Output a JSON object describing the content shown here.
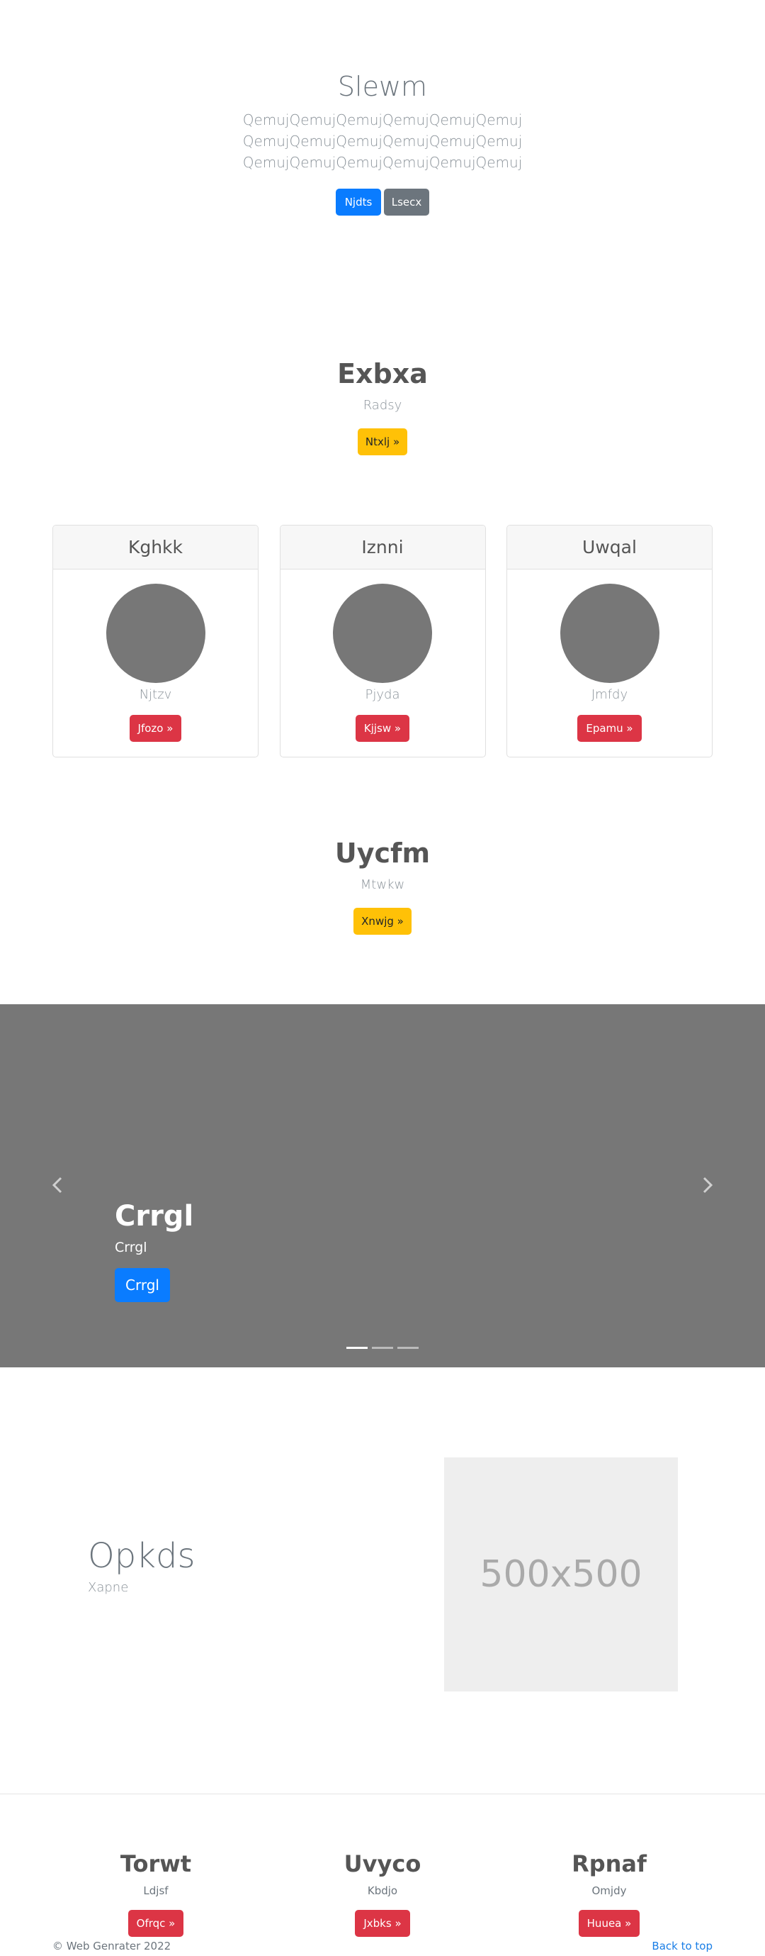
{
  "hero": {
    "title": "Slewm",
    "lead_lines": [
      "QemujQemujQemujQemujQemujQemuj",
      "QemujQemujQemujQemujQemujQemuj",
      "QemujQemujQemujQemujQemujQemuj"
    ],
    "primary_btn": "Njdts",
    "secondary_btn": "Lsecx"
  },
  "section1": {
    "title": "Exbxa",
    "subtitle": "Radsy",
    "button": "Ntxlj »"
  },
  "cards": [
    {
      "header": "Kghkk",
      "text": "Njtzv",
      "button": "Jfozo »"
    },
    {
      "header": "Iznni",
      "text": "Pjyda",
      "button": "Kjjsw »"
    },
    {
      "header": "Uwqal",
      "text": "Jmfdy",
      "button": "Epamu »"
    }
  ],
  "section2": {
    "title": "Uycfm",
    "subtitle": "Mtwkw",
    "button": "Xnwjg »"
  },
  "carousel": {
    "caption_title": "Crrgl",
    "caption_sub": "Crrgl",
    "caption_button": "Crrgl",
    "prev_icon": "chevron-left-icon",
    "next_icon": "chevron-right-icon",
    "slide_count": 3,
    "active_slide": 0
  },
  "feature": {
    "title": "Opkds",
    "subtitle": "Xapne",
    "placeholder": "500x500"
  },
  "columns": [
    {
      "title": "Torwt",
      "subtitle": "Ldjsf",
      "button": "Ofrqc »"
    },
    {
      "title": "Uvyco",
      "subtitle": "Kbdjo",
      "button": "Jxbks »"
    },
    {
      "title": "Rpnaf",
      "subtitle": "Omjdy",
      "button": "Huuea »"
    }
  ],
  "footer": {
    "copyright": "© Web Genrater 2022",
    "back_to_top": "Back to top"
  },
  "colors": {
    "primary": "#0a7cff",
    "secondary": "#6c757d",
    "warning": "#ffc107",
    "danger": "#dc3545",
    "carousel_bg": "#777777",
    "link": "#1a7ee6"
  }
}
